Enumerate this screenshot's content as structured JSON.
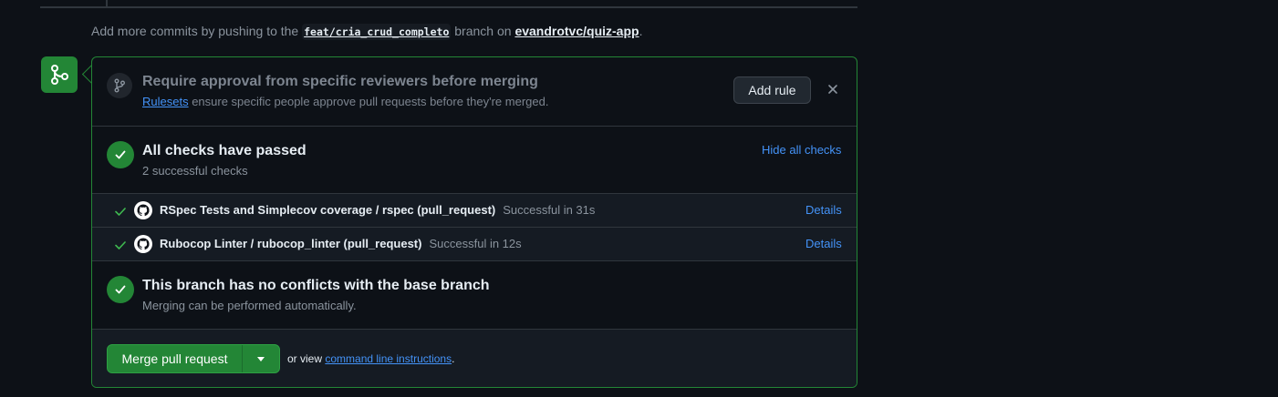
{
  "push_note": {
    "prefix": "Add more commits by pushing to the",
    "branch": "feat/cria_crud_completo",
    "middle": "branch on",
    "repo": "evandrotvc/quiz-app",
    "suffix": "."
  },
  "reviewers": {
    "title": "Require approval from specific reviewers before merging",
    "link": "Rulesets",
    "desc": " ensure specific people approve pull requests before they're merged.",
    "add_rule_label": "Add rule"
  },
  "checks": {
    "title": "All checks have passed",
    "subtitle": "2 successful checks",
    "hide_label": "Hide all checks",
    "items": [
      {
        "name": "RSpec Tests and Simplecov coverage / rspec (pull_request)",
        "status": "Successful in 31s",
        "details": "Details"
      },
      {
        "name": "Rubocop Linter / rubocop_linter (pull_request)",
        "status": "Successful in 12s",
        "details": "Details"
      }
    ]
  },
  "conflicts": {
    "title": "This branch has no conflicts with the base branch",
    "subtitle": "Merging can be performed automatically."
  },
  "merge": {
    "button_label": "Merge pull request",
    "or_view": "or view",
    "cli_link": "command line instructions",
    "suffix": "."
  },
  "colors": {
    "success": "#238636",
    "link": "#4493f8",
    "background": "#0d1117"
  },
  "icons": {
    "badge": "git-merge-icon",
    "reviewers": "git-branch-icon",
    "status": "check-icon",
    "provider": "github-icon",
    "dismiss": "x-icon",
    "dropdown": "triangle-down-icon"
  }
}
